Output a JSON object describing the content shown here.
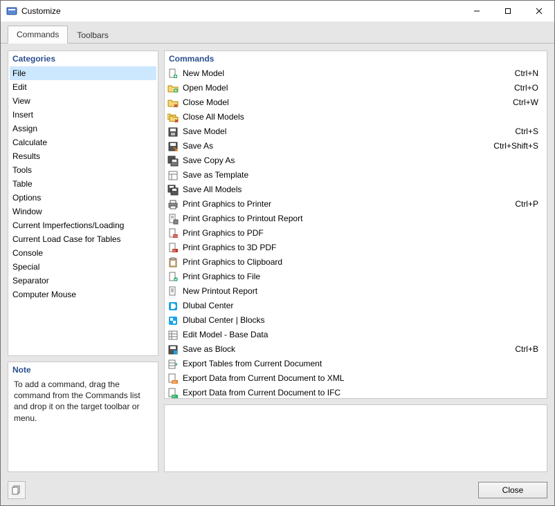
{
  "window": {
    "title": "Customize"
  },
  "tabs": [
    {
      "label": "Commands",
      "active": true
    },
    {
      "label": "Toolbars",
      "active": false
    }
  ],
  "categories": {
    "header": "Categories",
    "items": [
      "File",
      "Edit",
      "View",
      "Insert",
      "Assign",
      "Calculate",
      "Results",
      "Tools",
      "Table",
      "Options",
      "Window",
      "Current Imperfections/Loading",
      "Current Load Case for Tables",
      "Console",
      "Special",
      "Separator",
      "Computer Mouse"
    ],
    "selected_index": 0
  },
  "commands": {
    "header": "Commands",
    "items": [
      {
        "icon": "doc-new-icon",
        "label": "New Model",
        "shortcut": "Ctrl+N"
      },
      {
        "icon": "folder-open-icon",
        "label": "Open Model",
        "shortcut": "Ctrl+O"
      },
      {
        "icon": "folder-close-icon",
        "label": "Close Model",
        "shortcut": "Ctrl+W"
      },
      {
        "icon": "folder-close-all-icon",
        "label": "Close All Models",
        "shortcut": ""
      },
      {
        "icon": "save-icon",
        "label": "Save Model",
        "shortcut": "Ctrl+S"
      },
      {
        "icon": "save-as-icon",
        "label": "Save As",
        "shortcut": "Ctrl+Shift+S"
      },
      {
        "icon": "save-copy-icon",
        "label": "Save Copy As",
        "shortcut": ""
      },
      {
        "icon": "save-template-icon",
        "label": "Save as Template",
        "shortcut": ""
      },
      {
        "icon": "save-all-icon",
        "label": "Save All Models",
        "shortcut": ""
      },
      {
        "icon": "printer-icon",
        "label": "Print Graphics to Printer",
        "shortcut": "Ctrl+P"
      },
      {
        "icon": "print-report-icon",
        "label": "Print Graphics to Printout Report",
        "shortcut": ""
      },
      {
        "icon": "print-pdf-icon",
        "label": "Print Graphics to PDF",
        "shortcut": ""
      },
      {
        "icon": "print-3dpdf-icon",
        "label": "Print Graphics to 3D PDF",
        "shortcut": ""
      },
      {
        "icon": "clipboard-icon",
        "label": "Print Graphics to Clipboard",
        "shortcut": ""
      },
      {
        "icon": "file-image-icon",
        "label": "Print Graphics to File",
        "shortcut": ""
      },
      {
        "icon": "report-new-icon",
        "label": "New Printout Report",
        "shortcut": ""
      },
      {
        "icon": "dlubal-center-icon",
        "label": "Dlubal Center",
        "shortcut": ""
      },
      {
        "icon": "dlubal-blocks-icon",
        "label": "Dlubal Center | Blocks",
        "shortcut": ""
      },
      {
        "icon": "edit-model-icon",
        "label": "Edit Model - Base Data",
        "shortcut": ""
      },
      {
        "icon": "save-block-icon",
        "label": "Save as Block",
        "shortcut": "Ctrl+B"
      },
      {
        "icon": "export-tables-icon",
        "label": "Export Tables from Current Document",
        "shortcut": ""
      },
      {
        "icon": "export-xml-icon",
        "label": "Export Data from Current Document to XML",
        "shortcut": ""
      },
      {
        "icon": "export-ifc-icon",
        "label": "Export Data from Current Document to IFC",
        "shortcut": ""
      }
    ]
  },
  "note": {
    "header": "Note",
    "text": "To add a command, drag the command from the Commands list and drop it on the target toolbar or menu."
  },
  "footer": {
    "close_label": "Close"
  },
  "icons": {
    "app": "app-icon"
  }
}
